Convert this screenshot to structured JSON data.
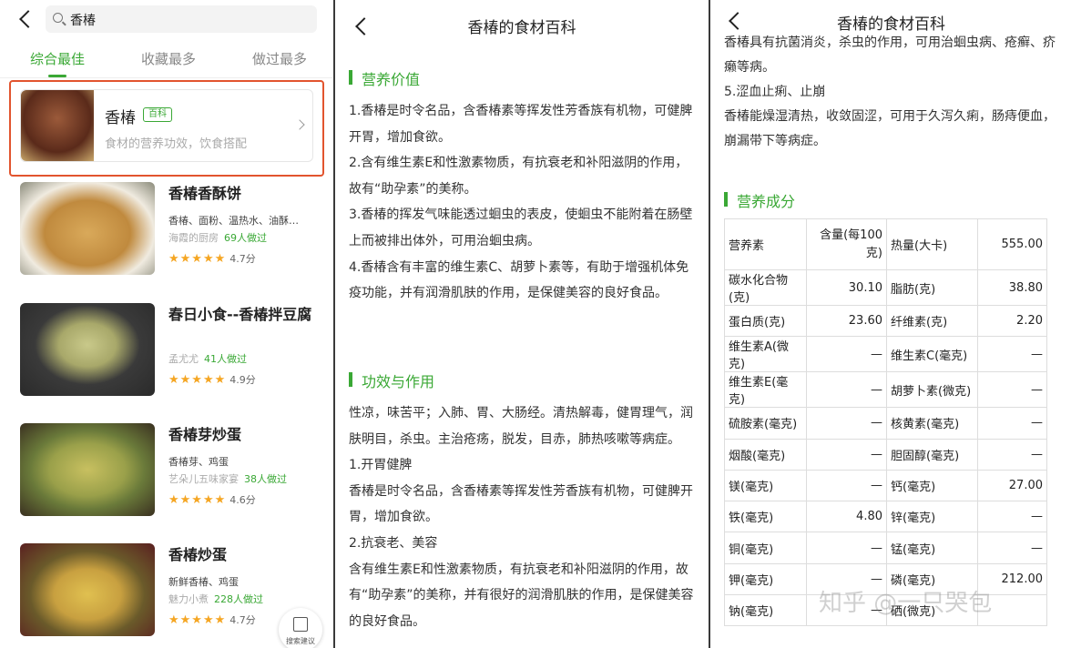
{
  "panel1": {
    "search": {
      "query": "香椿"
    },
    "tabs": [
      {
        "label": "综合最佳"
      },
      {
        "label": "收藏最多"
      },
      {
        "label": "做过最多"
      }
    ],
    "card": {
      "title": "香椿",
      "badge": "百科",
      "subtitle": "食材的营养功效，饮食搭配"
    },
    "recipes": [
      {
        "title": "香椿香酥饼",
        "ingredients": "香椿、面粉、温热水、油酥…",
        "author": "海霞的厨房",
        "made": "69人做过",
        "stars": "★★★★★",
        "score": "4.7分"
      },
      {
        "title": "春日小食--香椿拌豆腐",
        "ingredients": "",
        "author": "孟尤尤",
        "made": "41人做过",
        "stars": "★★★★★",
        "score": "4.9分"
      },
      {
        "title": "香椿芽炒蛋",
        "ingredients": "香椿芽、鸡蛋",
        "author": "艺朵儿五味家宴",
        "made": "38人做过",
        "stars": "★★★★★",
        "score": "4.6分"
      },
      {
        "title": "香椿炒蛋",
        "ingredients": "新鲜香椿、鸡蛋",
        "author": "魅力小煮",
        "made": "228人做过",
        "stars": "★★★★★",
        "score": "4.7分"
      }
    ],
    "fab_label": "搜索建议"
  },
  "panel2": {
    "title": "香椿的食材百科",
    "sec1": "营养价值",
    "nutrition": [
      "1.香椿是时令名品，含香椿素等挥发性芳香族有机物，可健脾开胃，增加食欲。",
      "2.含有维生素E和性激素物质，有抗衰老和补阳滋阴的作用，故有“助孕素”的美称。",
      "3.香椿的挥发气味能透过蛔虫的表皮，使蛔虫不能附着在肠壁上而被排出体外，可用治蛔虫病。",
      "4.香椿含有丰富的维生素C、胡萝卜素等，有助于增强机体免疫功能，并有润滑肌肤的作用，是保健美容的良好食品。"
    ],
    "sec2": "功效与作用",
    "effects": [
      "性凉，味苦平；入肺、胃、大肠经。清热解毒，健胃理气，润肤明目，杀虫。主治疮疡，脱发，目赤，肺热咳嗽等病症。",
      "1.开胃健脾",
      "香椿是时令名品，含香椿素等挥发性芳香族有机物，可健脾开胃，增加食欲。",
      "2.抗衰老、美容",
      "含有维生素E和性激素物质，有抗衰老和补阳滋阴的作用，故有“助孕素”的美称，并有很好的润滑肌肤的作用，是保健美容的良好食品。"
    ]
  },
  "panel3": {
    "title": "香椿的食材百科",
    "text": [
      "香椿具有抗菌消炎，杀虫的作用，可用治蛔虫病、疮癣、疥癞等病。",
      "5.涩血止痢、止崩",
      "香椿能燥湿清热，收敛固涩，可用于久泻久痢，肠痔便血，崩漏带下等病症。"
    ],
    "sec": "营养成分",
    "table": {
      "header": [
        "营养素",
        "含量(每100克)",
        "热量(大卡)",
        "555.00"
      ],
      "rows": [
        [
          "碳水化合物(克)",
          "30.10",
          "脂肪(克)",
          "38.80"
        ],
        [
          "蛋白质(克)",
          "23.60",
          "纤维素(克)",
          "2.20"
        ],
        [
          "维生素A(微克)",
          "—",
          "维生素C(毫克)",
          "—"
        ],
        [
          "维生素E(毫克)",
          "—",
          "胡萝卜素(微克)",
          "—"
        ],
        [
          "硫胺素(毫克)",
          "—",
          "核黄素(毫克)",
          "—"
        ],
        [
          "烟酸(毫克)",
          "—",
          "胆固醇(毫克)",
          "—"
        ],
        [
          "镁(毫克)",
          "—",
          "钙(毫克)",
          "27.00"
        ],
        [
          "铁(毫克)",
          "4.80",
          "锌(毫克)",
          "—"
        ],
        [
          "铜(毫克)",
          "—",
          "锰(毫克)",
          "—"
        ],
        [
          "钾(毫克)",
          "—",
          "磷(毫克)",
          "212.00"
        ],
        [
          "钠(毫克)",
          "—",
          "硒(微克)",
          ""
        ]
      ]
    },
    "watermark": "知乎 @一只哭包"
  }
}
